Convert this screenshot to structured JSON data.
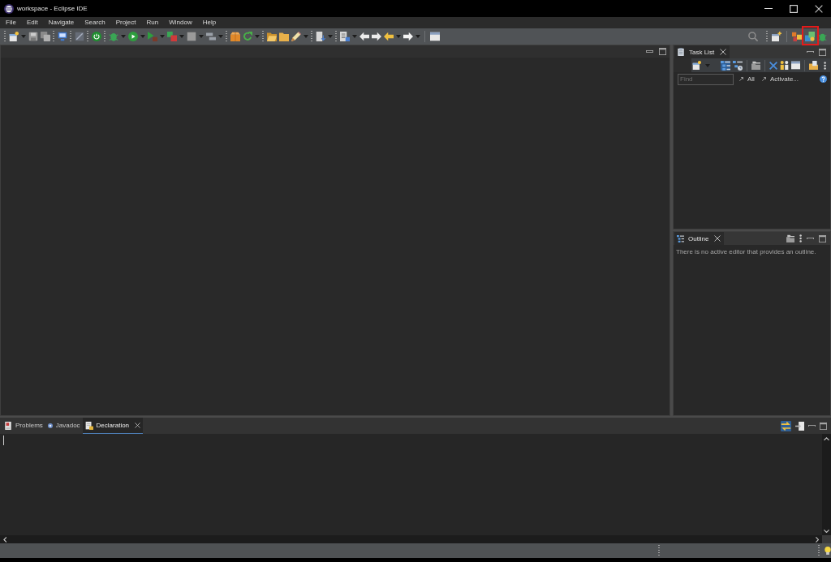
{
  "window": {
    "title": "workspace - Eclipse IDE"
  },
  "menu": [
    "File",
    "Edit",
    "Navigate",
    "Search",
    "Project",
    "Run",
    "Window",
    "Help"
  ],
  "task_list": {
    "tab": "Task List",
    "mode_buttons": [
      {
        "selected": true
      },
      {
        "selected": false
      }
    ],
    "find": {
      "placeholder": "Find"
    },
    "links": [
      "All",
      "Activate..."
    ]
  },
  "outline": {
    "tab": "Outline",
    "message": "There is no active editor that provides an outline."
  },
  "bottom_panel": {
    "tabs": [
      {
        "label": "Problems",
        "kind": "problems",
        "selected": false
      },
      {
        "label": "Javadoc",
        "kind": "javadoc",
        "selected": false
      },
      {
        "label": "Declaration",
        "kind": "declaration",
        "selected": true
      }
    ],
    "link_toggle": {
      "on": true
    }
  }
}
